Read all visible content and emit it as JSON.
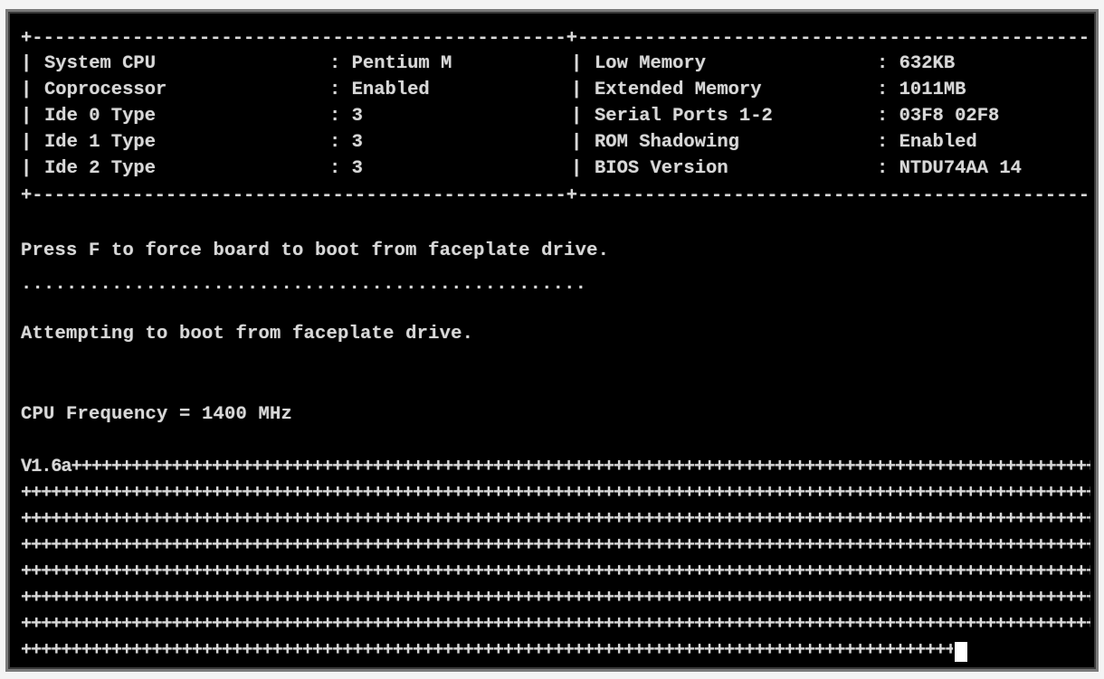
{
  "info_table": {
    "left": [
      {
        "label": "System CPU",
        "value": "Pentium M"
      },
      {
        "label": "Coprocessor",
        "value": "Enabled"
      },
      {
        "label": "Ide 0 Type",
        "value": "3"
      },
      {
        "label": "Ide 1 Type",
        "value": "3"
      },
      {
        "label": "Ide 2 Type",
        "value": "3"
      }
    ],
    "right": [
      {
        "label": "Low Memory",
        "value": "632KB"
      },
      {
        "label": "Extended Memory",
        "value": "1011MB"
      },
      {
        "label": "Serial Ports 1-2",
        "value": "03F8 02F8"
      },
      {
        "label": "ROM Shadowing",
        "value": "Enabled"
      },
      {
        "label": "BIOS Version",
        "value": "NTDU74AA 14"
      }
    ]
  },
  "messages": {
    "press_f": "Press F to force board to boot from faceplate drive.",
    "dots": "..................................................",
    "attempting": "Attempting to boot from faceplate drive.",
    "cpu_freq": "CPU Frequency = 1400 MHz",
    "version_prefix": "V1.6a"
  },
  "colors": {
    "screen_bg": "#000000",
    "text": "#d8d8d8",
    "cursor": "#ffffff"
  }
}
